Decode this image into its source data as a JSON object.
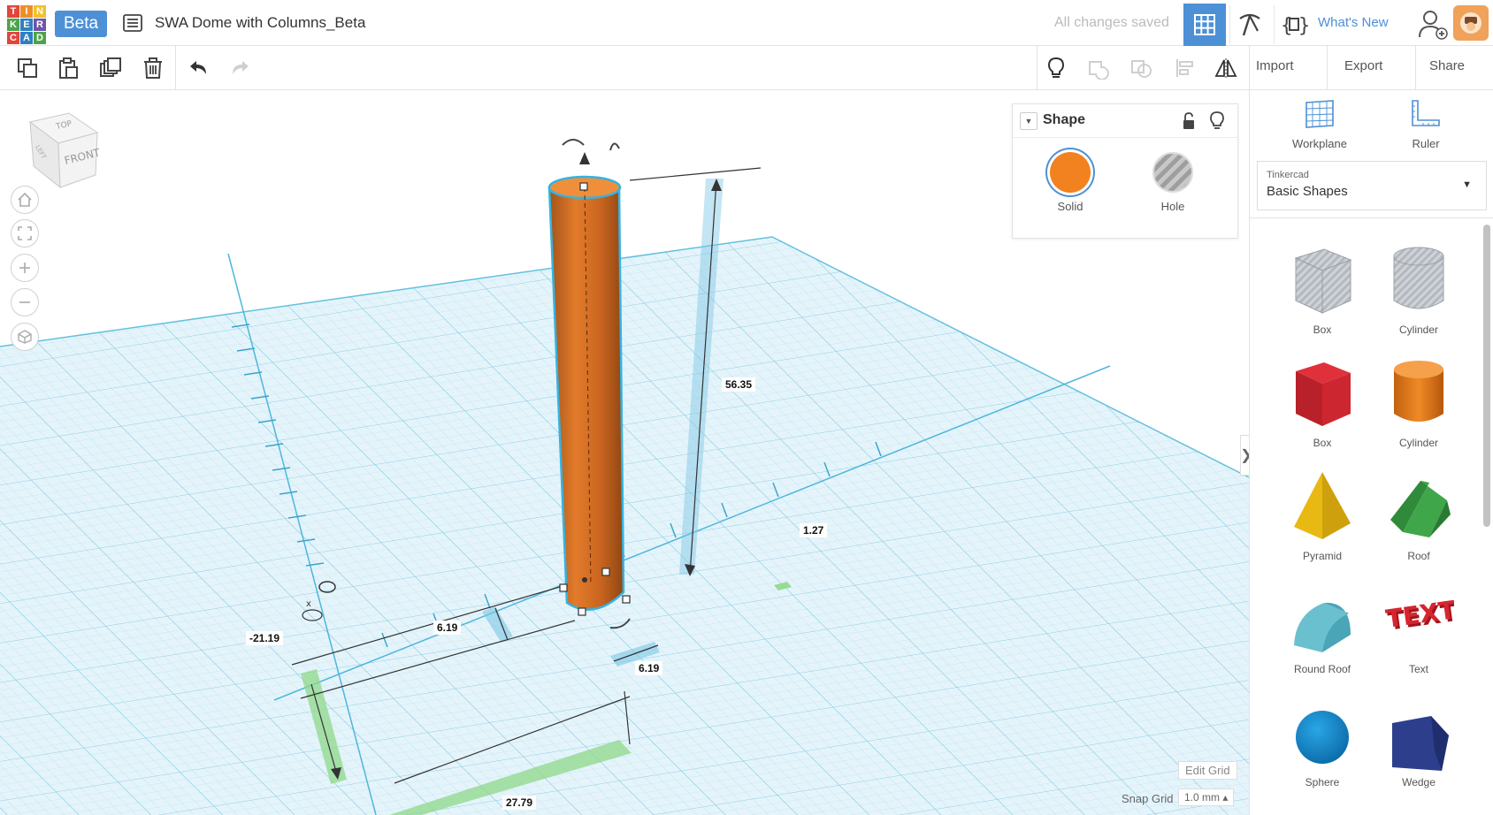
{
  "app": {
    "logo_letters": [
      "T",
      "I",
      "N",
      "K",
      "E",
      "R",
      "C",
      "A",
      "D"
    ],
    "logo_colors": [
      "#e2453c",
      "#ed8f28",
      "#f2c12e",
      "#4ea34b",
      "#2f7fc2",
      "#6e54a5",
      "#e2453c",
      "#2f7fc2",
      "#4ea34b"
    ],
    "badge": "Beta",
    "document_title": "SWA Dome with Columns_Beta",
    "save_status": "All changes saved",
    "whats_new": "What's New",
    "accent_color": "#4d90d6"
  },
  "toolbar": {
    "import_label": "Import",
    "export_label": "Export",
    "share_label": "Share"
  },
  "viewcube": {
    "top": "TOP",
    "front": "FRONT",
    "side": "LEFT"
  },
  "dimensions": {
    "height": "56.35",
    "offset_right": "1.27",
    "width": "6.19",
    "depth": "6.19",
    "x_pos": "-21.19",
    "y_pos": "27.79"
  },
  "grid": {
    "edit_grid": "Edit Grid",
    "snap_grid_label": "Snap Grid",
    "snap_grid_value": "1.0 mm ▴"
  },
  "inspector": {
    "title": "Shape",
    "solid_label": "Solid",
    "hole_label": "Hole",
    "solid_color": "#f28120"
  },
  "panel": {
    "workplane_label": "Workplane",
    "ruler_label": "Ruler",
    "library_caption": "Tinkercad",
    "library_value": "Basic Shapes",
    "shapes": [
      {
        "label": "Box",
        "kind": "box-hole"
      },
      {
        "label": "Cylinder",
        "kind": "cylinder-hole"
      },
      {
        "label": "Box",
        "kind": "box-red"
      },
      {
        "label": "Cylinder",
        "kind": "cylinder-orange"
      },
      {
        "label": "Pyramid",
        "kind": "pyramid"
      },
      {
        "label": "Roof",
        "kind": "roof"
      },
      {
        "label": "Round Roof",
        "kind": "round-roof"
      },
      {
        "label": "Text",
        "kind": "text"
      },
      {
        "label": "Sphere",
        "kind": "sphere"
      },
      {
        "label": "Wedge",
        "kind": "wedge"
      }
    ]
  }
}
